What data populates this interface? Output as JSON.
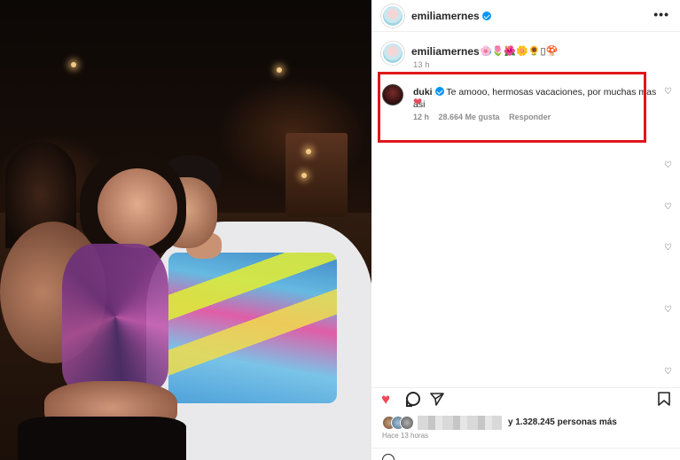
{
  "post": {
    "author": "emiliamernes",
    "more_label": "•••"
  },
  "caption": {
    "author": "emiliamernes",
    "emojis": "🌸🌷🌺🌼🌻▯🍄",
    "time": "13 h"
  },
  "comment": {
    "author": "duki",
    "text": "Te amooo, hermosas vacaciones, por muchas mas asi",
    "heart": "❤",
    "time": "12 h",
    "likes": "28.664 Me gusta",
    "reply": "Responder"
  },
  "likes": {
    "text": "y 1.328.245 personas más"
  },
  "timestamp": "Hace 13 horas",
  "icons": {
    "like": "heart-filled-icon",
    "comment": "comment-bubble-icon",
    "share": "paper-plane-icon",
    "save": "bookmark-icon",
    "comment_like": "heart-outline-icon"
  },
  "colors": {
    "like_red": "#ed4956",
    "verified_blue": "#0095f6",
    "highlight_red": "#e0161b"
  }
}
